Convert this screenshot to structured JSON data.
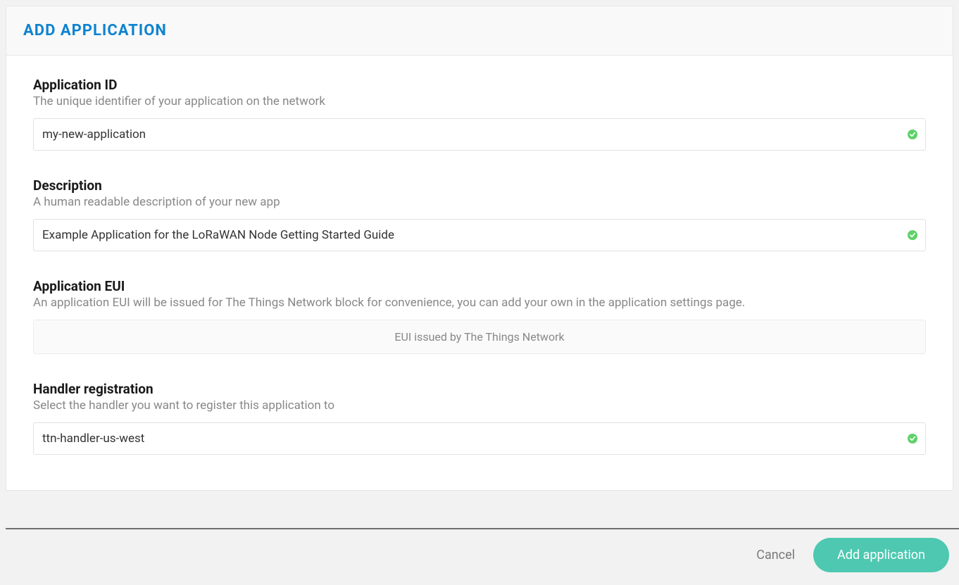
{
  "header": {
    "title": "Add Application"
  },
  "fields": {
    "app_id": {
      "label": "Application ID",
      "help": "The unique identifier of your application on the network",
      "value": "my-new-application",
      "valid": true
    },
    "description": {
      "label": "Description",
      "help": "A human readable description of your new app",
      "value": "Example Application for the LoRaWAN Node Getting Started Guide",
      "valid": true
    },
    "app_eui": {
      "label": "Application EUI",
      "help": "An application EUI will be issued for The Things Network block for convenience, you can add your own in the application settings page.",
      "placeholder_text": "EUI issued by The Things Network"
    },
    "handler": {
      "label": "Handler registration",
      "help": "Select the handler you want to register this application to",
      "value": "ttn-handler-us-west",
      "valid": true
    }
  },
  "actions": {
    "cancel": "Cancel",
    "submit": "Add application"
  },
  "colors": {
    "accent": "#0d83d0",
    "primary_btn": "#4ec8b0",
    "valid": "#5ed169"
  }
}
